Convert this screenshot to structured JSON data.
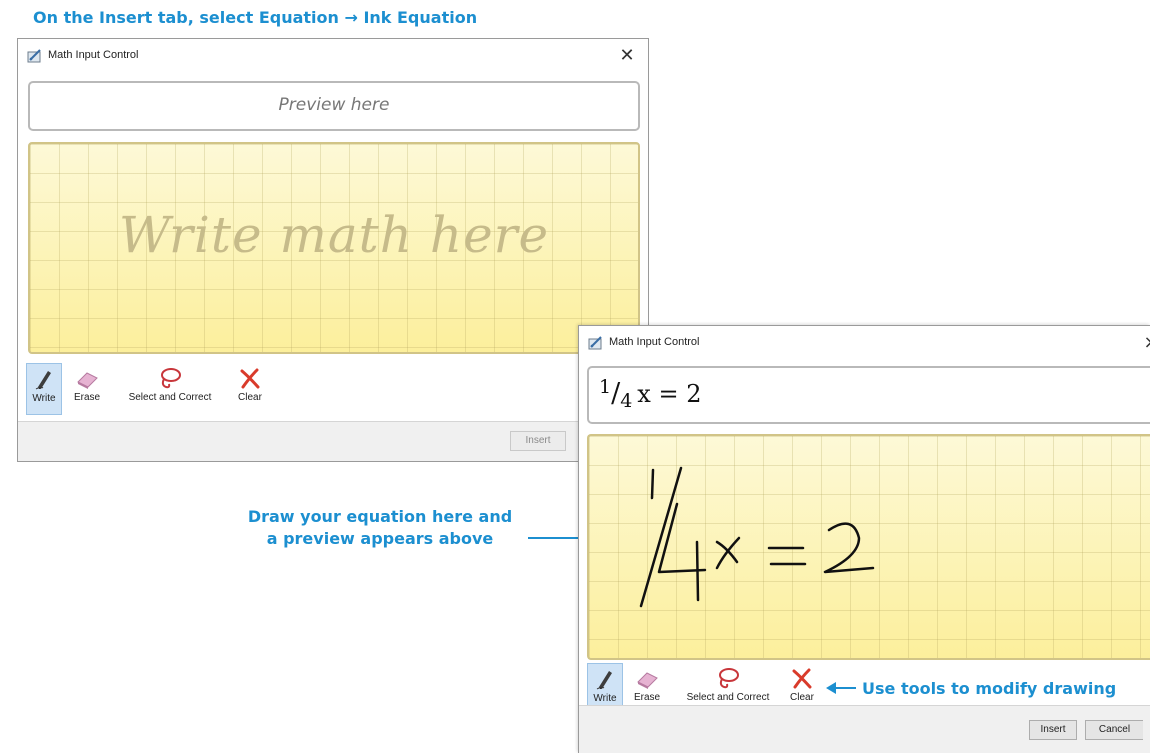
{
  "heading": "On the Insert tab, select Equation → Ink Equation",
  "callouts": {
    "draw_line1": "Draw your equation here and",
    "draw_line2": "a preview appears above",
    "tools": "Use tools to modify drawing"
  },
  "window_empty": {
    "title": "Math Input Control",
    "close_glyph": "✕",
    "preview_placeholder": "Preview here",
    "canvas_placeholder": "Write math here",
    "tools": {
      "write": "Write",
      "erase": "Erase",
      "select": "Select and Correct",
      "clear": "Clear"
    },
    "insert_label": "Insert"
  },
  "window_filled": {
    "title": "Math Input Control",
    "close_glyph": "×",
    "preview_math": {
      "numerator": "1",
      "slash": "/",
      "denominator": "4",
      "rest": "x = 2"
    },
    "tools": {
      "write": "Write",
      "erase": "Erase",
      "select": "Select and Correct",
      "clear": "Clear"
    },
    "insert_label": "Insert",
    "cancel_label": "Cancel"
  },
  "colors": {
    "callout": "#1c8fd0",
    "canvas": "#fdf6bf",
    "clear_icon": "#d93b2b",
    "select_icon": "#c8363b"
  }
}
